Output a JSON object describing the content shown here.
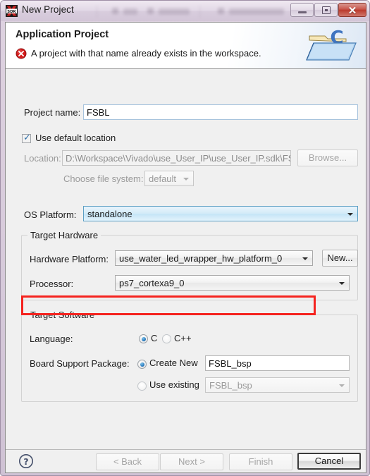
{
  "window": {
    "title": "New Project",
    "app_icon": "sdk-logo-icon",
    "controls": {
      "minimize": "minimize-icon",
      "maximize": "maximize-icon",
      "close_glyph": "✕"
    }
  },
  "header": {
    "title": "Application Project",
    "status_icon": "error-icon",
    "message": "A project with that name already exists in the workspace.",
    "banner_icon": "c-folder-icon",
    "banner_letter": "C"
  },
  "form": {
    "project_name_label": "Project name:",
    "project_name_value": "FSBL",
    "project_name_placeholder": "",
    "use_default_location_label": "Use default location",
    "use_default_location_checked": true,
    "location_label": "Location:",
    "location_value": "D:\\Workspace\\Vivado\\use_User_IP\\use_User_IP.sdk\\FSI",
    "choose_file_system_label": "Choose file system:",
    "choose_file_system_value": "default",
    "os_platform_label": "OS Platform:",
    "os_platform_value": "standalone"
  },
  "target_hardware": {
    "group_label": "Target Hardware",
    "hardware_platform_label": "Hardware Platform:",
    "hardware_platform_value": "use_water_led_wrapper_hw_platform_0",
    "new_button_label": "New...",
    "processor_label": "Processor:",
    "processor_value": "ps7_cortexa9_0",
    "highlight_color": "#f5231f"
  },
  "target_software": {
    "group_label": "Target Software",
    "language_label": "Language:",
    "language_options": [
      {
        "label": "C",
        "selected": true
      },
      {
        "label": "C++",
        "selected": false
      }
    ],
    "bsp_label": "Board Support Package:",
    "bsp_create_new_label": "Create New",
    "bsp_create_new_selected": true,
    "bsp_create_new_value": "FSBL_bsp",
    "bsp_use_existing_label": "Use existing",
    "bsp_use_existing_selected": false,
    "bsp_use_existing_value": "FSBL_bsp"
  },
  "buttons": {
    "browse_label": "Browse...",
    "help_icon": "help-question-icon",
    "back_label": "< Back",
    "next_label": "Next >",
    "finish_label": "Finish",
    "cancel_label": "Cancel"
  }
}
